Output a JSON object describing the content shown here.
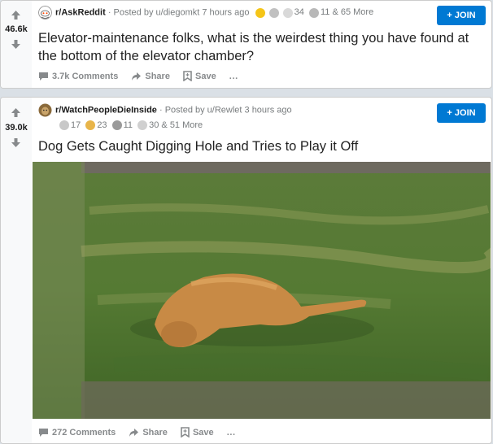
{
  "posts": [
    {
      "subreddit": "r/AskReddit",
      "posted_by": "· Posted by u/diegomkt 7 hours ago",
      "awards_text": "34",
      "awards_more": "11 & 65 More",
      "score": "46.6k",
      "title": "Elevator-maintenance folks, what is the weirdest thing you have found at the bottom of the elevator chamber?",
      "comments": "3.7k Comments",
      "share": "Share",
      "save": "Save",
      "more": "···",
      "join": "+ JOIN",
      "icon": "askreddit-alien-icon"
    },
    {
      "subreddit": "r/WatchPeopleDieInside",
      "posted_by": "· Posted by u/Rewlet 3 hours ago",
      "award_a": "17",
      "award_b": "23",
      "award_c": "11",
      "award_d": "30",
      "awards_more": "& 51 More",
      "score": "39.0k",
      "title": "Dog Gets Caught Digging Hole and Tries to Play it Off",
      "comments": "272 Comments",
      "share": "Share",
      "save": "Save",
      "more": "···",
      "join": "+ JOIN",
      "icon": "dog-avatar-icon",
      "media": "dog-lying-on-grass-video"
    }
  ],
  "colors": {
    "join": "#0079d3",
    "page_bg": "#dae0e6",
    "meta": "#787c7e"
  }
}
